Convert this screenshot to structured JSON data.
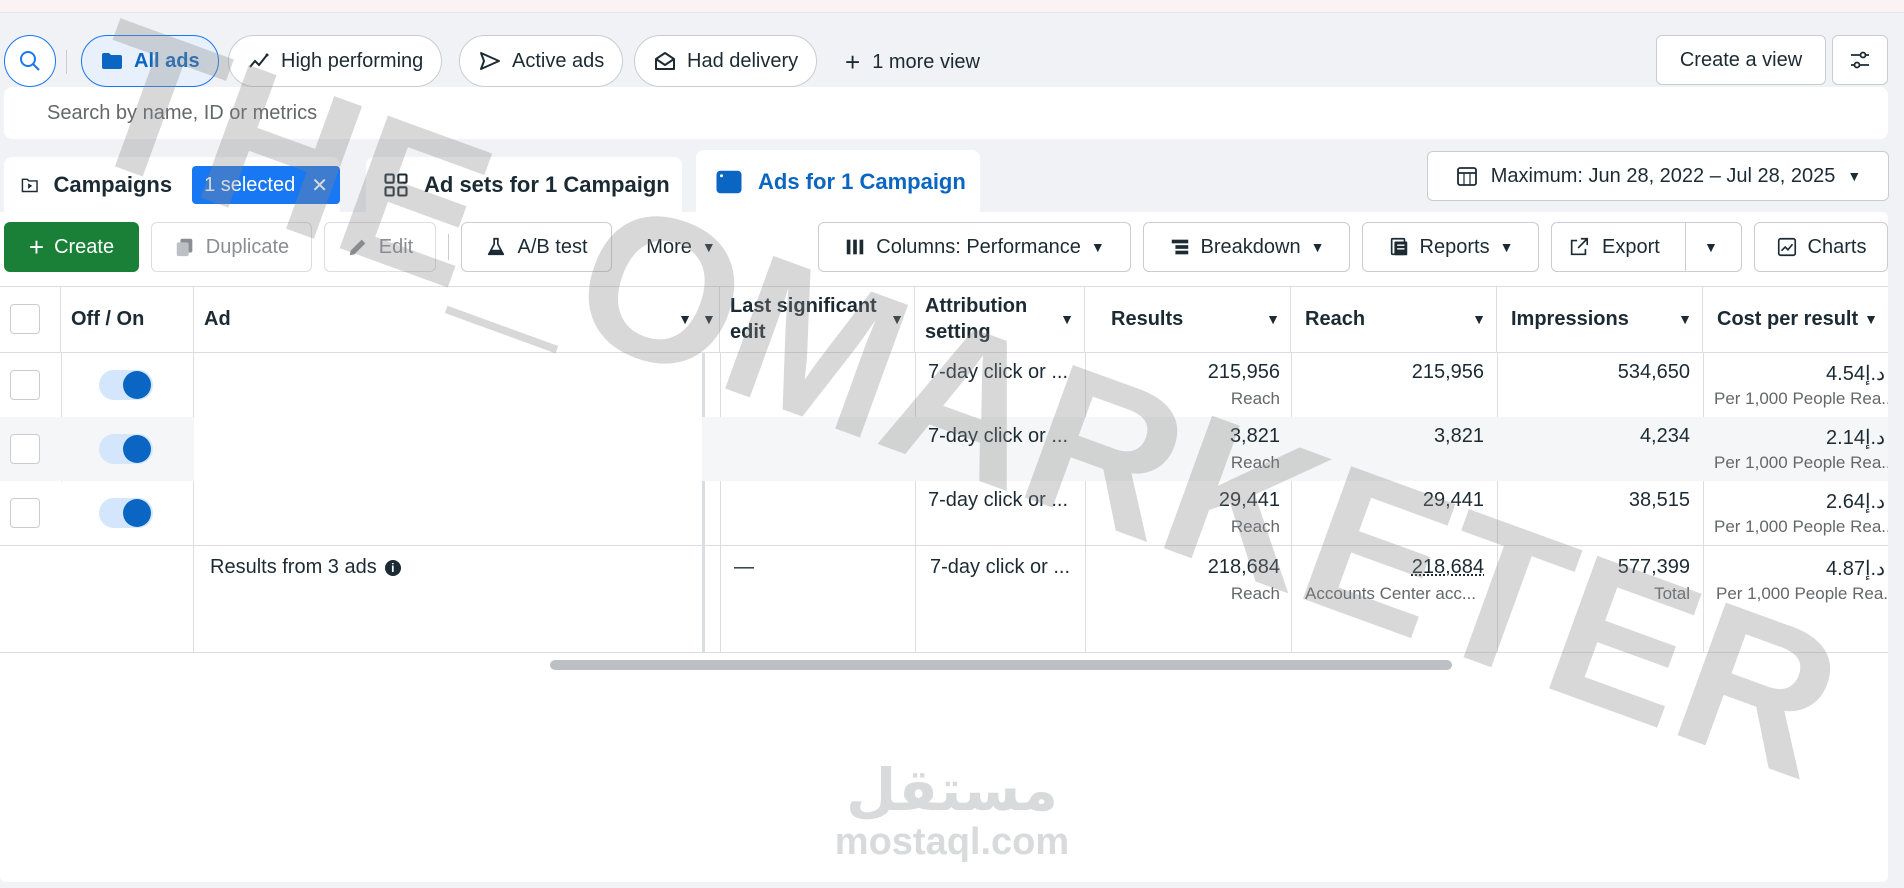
{
  "views": {
    "all_ads": "All ads",
    "high_performing": "High performing",
    "active_ads": "Active ads",
    "had_delivery": "Had delivery",
    "more_views": "1 more view",
    "create_view": "Create a view"
  },
  "search": {
    "placeholder": "Search by name, ID or metrics"
  },
  "tabs": {
    "campaigns": "Campaigns",
    "selected_badge": "1 selected",
    "ad_sets": "Ad sets for 1 Campaign",
    "ads": "Ads for 1 Campaign"
  },
  "date_range": "Maximum: Jun 28, 2022 – Jul 28, 2025",
  "toolbar": {
    "create": "Create",
    "duplicate": "Duplicate",
    "edit": "Edit",
    "ab_test": "A/B test",
    "more": "More",
    "columns": "Columns: Performance",
    "breakdown": "Breakdown",
    "reports": "Reports",
    "export": "Export",
    "charts": "Charts"
  },
  "table": {
    "headers": {
      "off_on": "Off / On",
      "ad": "Ad",
      "last_edit": "Last significant edit",
      "attribution": "Attribution setting",
      "results": "Results",
      "reach": "Reach",
      "impressions": "Impressions",
      "cost_per_result": "Cost per result"
    },
    "rows": [
      {
        "attribution": "7-day click or ...",
        "results": "215,956",
        "results_sub": "Reach",
        "reach": "215,956",
        "impressions": "534,650",
        "cost": "4.54د.إ",
        "cost_sub": "Per 1,000 People Rea..."
      },
      {
        "attribution": "7-day click or ...",
        "results": "3,821",
        "results_sub": "Reach",
        "reach": "3,821",
        "impressions": "4,234",
        "cost": "2.14د.إ",
        "cost_sub": "Per 1,000 People Rea..."
      },
      {
        "attribution": "7-day click or ...",
        "results": "29,441",
        "results_sub": "Reach",
        "reach": "29,441",
        "impressions": "38,515",
        "cost": "2.64د.إ",
        "cost_sub": "Per 1,000 People Rea..."
      }
    ],
    "summary": {
      "label": "Results from 3 ads",
      "last_edit": "—",
      "attribution": "7-day click or ...",
      "results": "218,684",
      "results_sub": "Reach",
      "reach": "218,684",
      "reach_sub": "Accounts Center acc...",
      "impressions": "577,399",
      "impressions_sub": "Total",
      "cost": "4.87د.إ",
      "cost_sub": "Per 1,000 People Rea..."
    }
  },
  "watermark": {
    "text": "THE_OMARKETER",
    "logo_ar": "مستقل",
    "logo_en": "mostaql.com"
  },
  "colors": {
    "accent": "#1877f2",
    "create_green": "#1a7f37",
    "toggle_on": "#0a66c2"
  }
}
